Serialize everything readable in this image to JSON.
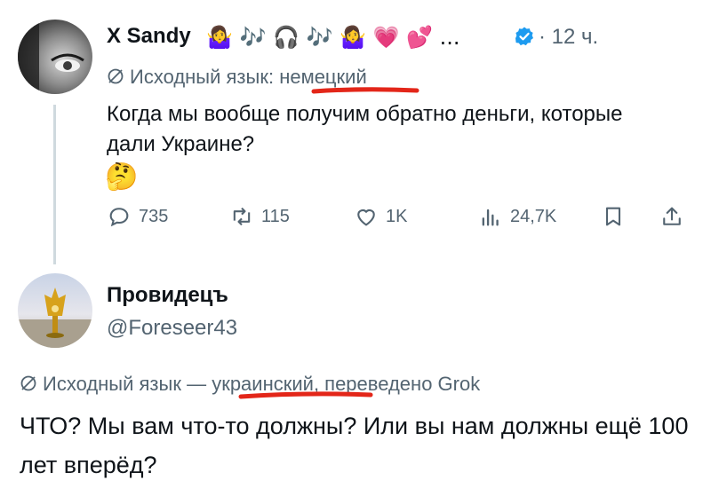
{
  "tweet1": {
    "author_name": "X Sandy",
    "author_emojis": "🤷‍♀️ 🎶 🎧 🎶 🤷‍♀️ 💗 💕 ...",
    "time": "· 12 ч.",
    "lang_prefix": "Исходный язык: ",
    "lang_value": "немецкий",
    "text": "Когда мы вообще получим обратно деньги, которые дали Украине?",
    "emoji": "🤔",
    "replies": "735",
    "reposts": "115",
    "likes": "1K",
    "views": "24,7K"
  },
  "tweet2": {
    "author_name": "Провидецъ",
    "handle": "@Foreseer43",
    "lang_prefix": "Исходный язык — ",
    "lang_value": "украинский",
    "lang_suffix": ", переведено Grok",
    "text": "ЧТО? Мы вам что-то должны? Или вы нам должны ещё 100 лет вперёд?"
  },
  "colors": {
    "text": "#0f1419",
    "muted": "#536471",
    "verified": "#1d9bf0",
    "annotation": "#e32619",
    "thread_line": "#cfd9de"
  },
  "icons": [
    "translate-icon",
    "reply-icon",
    "repost-icon",
    "like-icon",
    "views-icon",
    "bookmark-icon",
    "share-icon",
    "verified-icon",
    "thinking-face-icon"
  ]
}
